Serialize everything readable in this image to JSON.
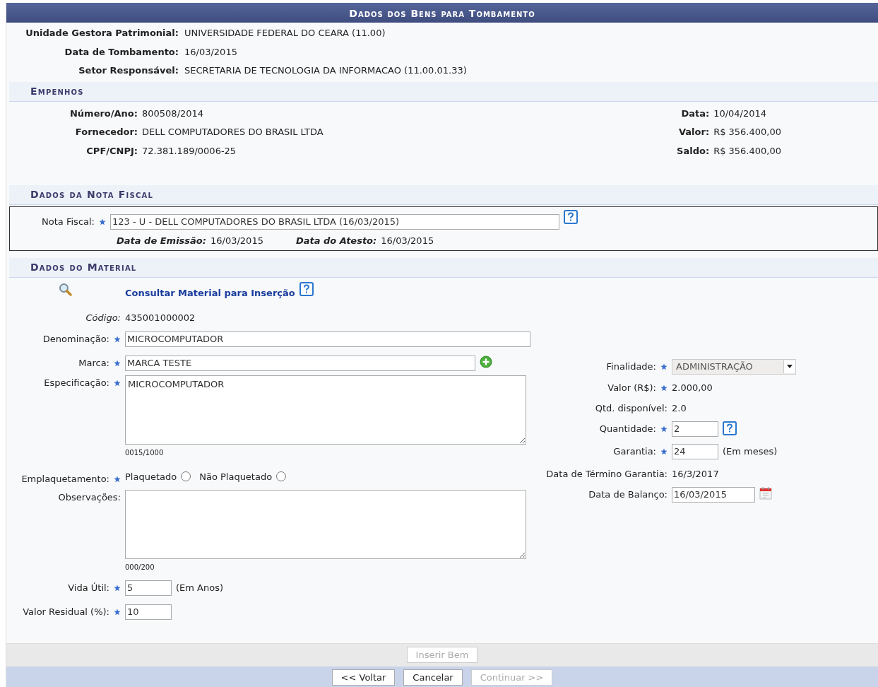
{
  "title": "Dados dos Bens para Tombamento",
  "header_fields": [
    {
      "label": "Unidade Gestora Patrimonial:",
      "value": "UNIVERSIDADE FEDERAL DO CEARA (11.00)"
    },
    {
      "label": "Data de Tombamento:",
      "value": "16/03/2015"
    },
    {
      "label": "Setor Responsável:",
      "value": "SECRETARIA DE TECNOLOGIA DA INFORMACAO (11.00.01.33)"
    }
  ],
  "empenhos": {
    "heading": "Empenhos",
    "left": [
      {
        "label": "Número/Ano:",
        "value": "800508/2014"
      },
      {
        "label": "Fornecedor:",
        "value": "DELL COMPUTADORES DO BRASIL LTDA"
      },
      {
        "label": "CPF/CNPJ:",
        "value": "72.381.189/0006-25"
      }
    ],
    "right": [
      {
        "label": "Data:",
        "value": "10/04/2014"
      },
      {
        "label": "Valor:",
        "value": "R$ 356.400,00"
      },
      {
        "label": "Saldo:",
        "value": "R$ 356.400,00"
      }
    ]
  },
  "nota_fiscal": {
    "heading": "Dados da Nota Fiscal",
    "field": {
      "label": "Nota Fiscal:",
      "required": true,
      "value": "123 - U - DELL COMPUTADORES DO BRASIL LTDA (16/03/2015)"
    },
    "details": [
      {
        "label": "Data de Emissão:",
        "value": "16/03/2015"
      },
      {
        "label": "Data do Atesto:",
        "value": "16/03/2015"
      }
    ]
  },
  "material": {
    "heading": "Dados do Material",
    "search_link": "Consultar Material para Inserção",
    "left": [
      {
        "kind": "text",
        "label": "Código:",
        "value": "435001000002",
        "required": false
      },
      {
        "kind": "wide-input",
        "label": "Denominação:",
        "value": "MICROCOMPUTADOR",
        "required": true
      },
      {
        "kind": "medium-input",
        "label": "Marca:",
        "value": "MARCA TESTE",
        "required": true,
        "add_button": true
      },
      {
        "kind": "textarea",
        "label": "Especificação:",
        "value": "MICROCOMPUTADOR",
        "required": true,
        "counter": "0015/1000"
      },
      {
        "kind": "radio",
        "label": "Emplaquetamento:",
        "required": true,
        "options": [
          {
            "label": "Plaquetado",
            "selected": false
          },
          {
            "label": "Não Plaquetado",
            "selected": false
          }
        ]
      },
      {
        "kind": "textarea",
        "label": "Observações:",
        "required": false,
        "counter": "000/200"
      },
      {
        "kind": "short-input",
        "label": "Vida Útil:",
        "value": "5",
        "required": true,
        "unit": "(Em Anos)"
      },
      {
        "kind": "short-input",
        "label": "Valor Residual (%):",
        "value": "10",
        "required": true
      }
    ],
    "right": [
      {
        "kind": "select",
        "label": "Finalidade:",
        "value": "ADMINISTRAÇÃO",
        "required": true
      },
      {
        "kind": "text",
        "label": "Valor (R$):",
        "value": "2.000,00",
        "required": true
      },
      {
        "kind": "text",
        "label": "Qtd. disponível:",
        "value": "2.0",
        "required": false
      },
      {
        "kind": "short-input",
        "label": "Quantidade:",
        "value": "2",
        "required": true,
        "help": true
      },
      {
        "kind": "short-input",
        "label": "Garantia:",
        "value": "24",
        "required": true,
        "unit": "(Em meses)"
      },
      {
        "kind": "text",
        "label": "Data de Término Garantia:",
        "value": "16/3/2017",
        "required": false
      },
      {
        "kind": "date",
        "label": "Data de Balanço:",
        "value": "16/03/2015",
        "required": false
      }
    ]
  },
  "insert_button": {
    "label": "Inserir Bem",
    "disabled": true
  },
  "nav_buttons": [
    {
      "label": "<< Voltar",
      "disabled": false
    },
    {
      "label": "Cancelar",
      "disabled": false
    },
    {
      "label": "Continuar >>",
      "disabled": true
    }
  ]
}
